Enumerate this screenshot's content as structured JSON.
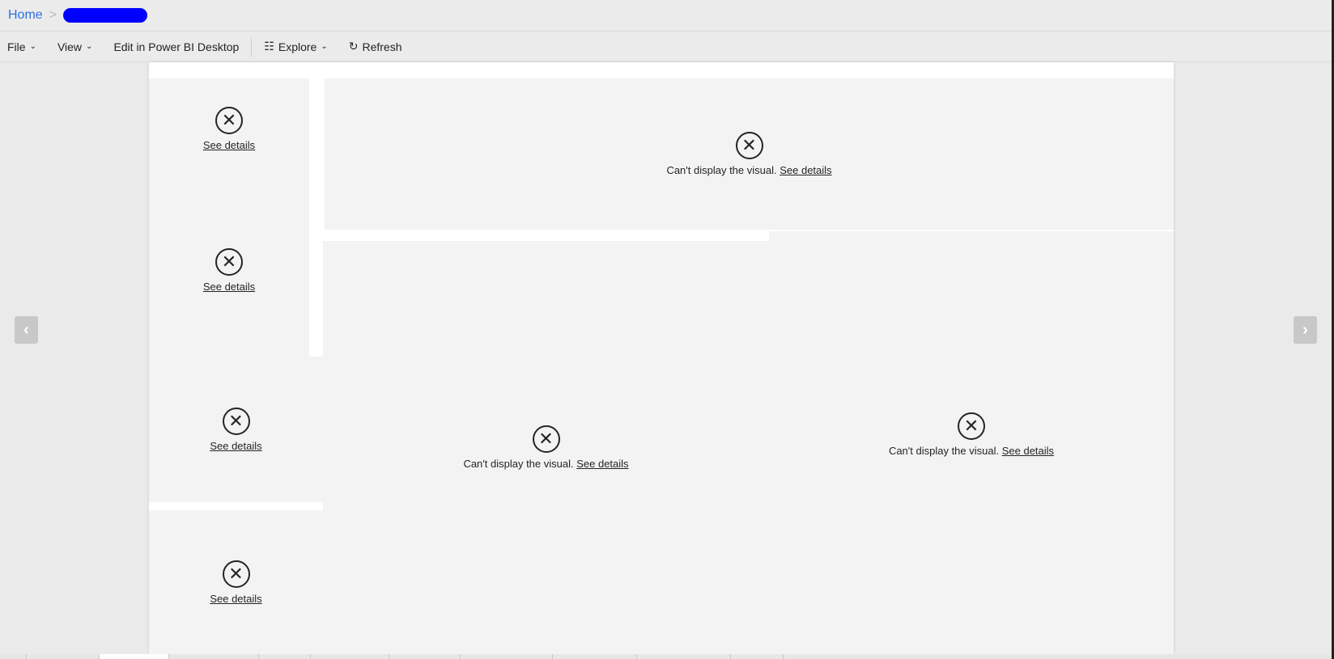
{
  "breadcrumb": {
    "home": "Home",
    "separator": ">"
  },
  "toolbar": {
    "file": "File",
    "view": "View",
    "edit": "Edit in Power BI Desktop",
    "explore": "Explore",
    "refresh": "Refresh"
  },
  "visuals": {
    "error_message": "Can't display the visual.",
    "details_link": "See details"
  },
  "nav": {
    "prev": "‹",
    "next": "›"
  }
}
